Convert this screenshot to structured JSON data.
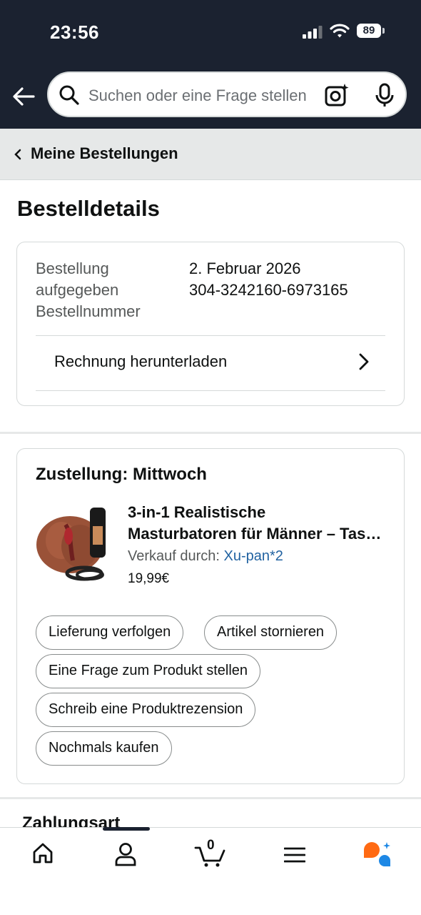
{
  "status_bar": {
    "time": "23:56",
    "battery": "89"
  },
  "search": {
    "placeholder": "Suchen oder eine Frage stellen"
  },
  "breadcrumb": {
    "label": "Meine Bestellungen"
  },
  "page": {
    "title": "Bestelldetails"
  },
  "order": {
    "labels": [
      "Bestellung",
      "aufgegeben",
      "Bestellnummer"
    ],
    "date": "2. Februar 2026",
    "number": "304-3242160-6973165",
    "invoice_link": "Rechnung herunterladen"
  },
  "delivery": {
    "heading": "Zustellung: Mittwoch",
    "product": {
      "name_line1": "3-in-1 Realistische",
      "name_line2": "Masturbatoren für Männer – Taschenmuschi mit Vibrator",
      "sold_by_label": "Verkauf durch:",
      "seller": "Xu-pan*2",
      "price": "19,99€"
    },
    "actions": [
      "Lieferung verfolgen",
      "Artikel stornieren",
      "Eine Frage zum Produkt stellen",
      "Schreib eine Produktrezension",
      "Nochmals kaufen"
    ]
  },
  "payment": {
    "heading": "Zahlungsart"
  },
  "tabbar": {
    "cart_count": "0",
    "icons": [
      "home-icon",
      "account-icon",
      "cart-icon",
      "menu-icon",
      "rufus-icon"
    ]
  },
  "colors": {
    "header": "#1b2230",
    "link": "#2162a1",
    "rufus_orange": "#ff6a13",
    "rufus_blue": "#1e88e5"
  }
}
